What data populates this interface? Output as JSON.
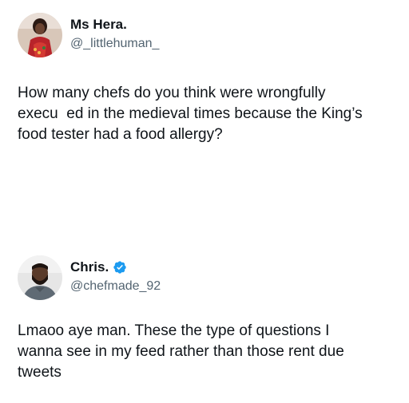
{
  "tweets": [
    {
      "display_name": "Ms Hera.",
      "handle": "@_littlehuman_",
      "verified": false,
      "text": "How many chefs do you think were wrongfully\nexecu  ed in the medieval times because the King’s\nfood tester had a food allergy?"
    },
    {
      "display_name": "Chris.",
      "handle": "@chefmade_92",
      "verified": true,
      "text": "Lmaoo aye man. These the type of questions I\nwanna see in my feed rather than those rent due\ntweets"
    }
  ],
  "colors": {
    "text": "#0f1419",
    "secondary": "#536471",
    "verified_badge": "#1d9bf0"
  }
}
